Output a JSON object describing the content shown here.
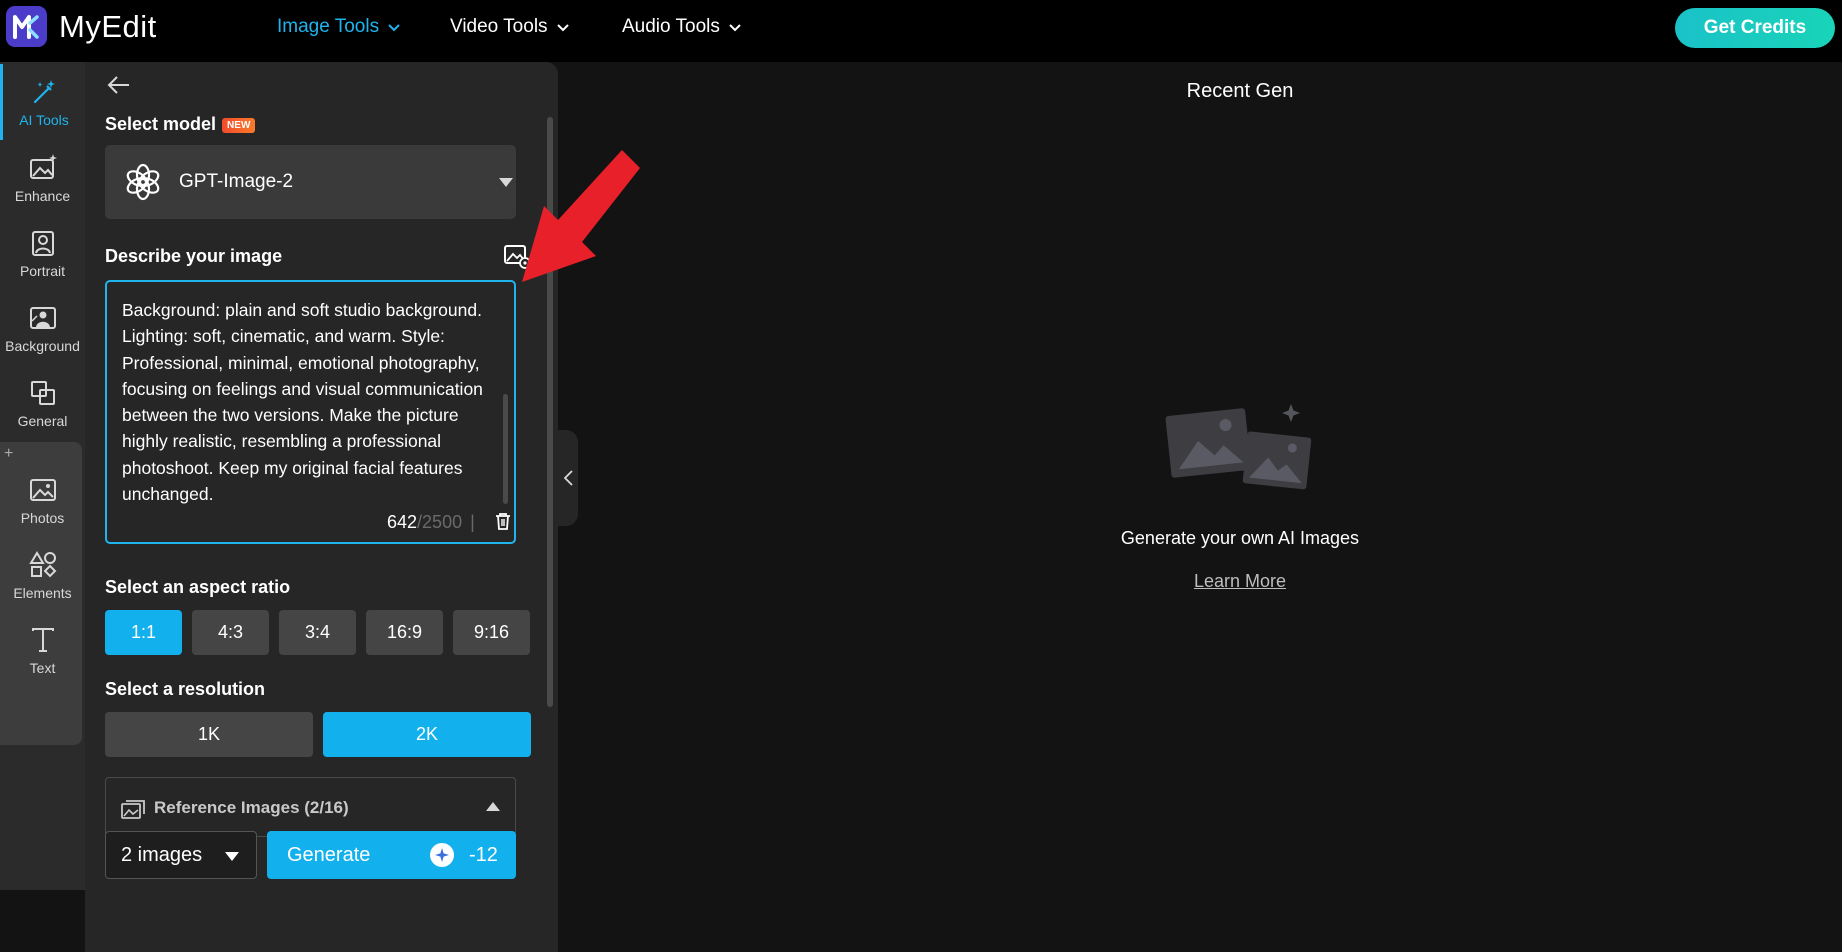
{
  "app": {
    "name": "MyEdit"
  },
  "nav": {
    "image_tools": "Image Tools",
    "video_tools": "Video Tools",
    "audio_tools": "Audio Tools",
    "get_credits": "Get Credits"
  },
  "rail": {
    "items": [
      {
        "label": "AI Tools",
        "icon": "magic-wand-icon"
      },
      {
        "label": "Enhance",
        "icon": "enhance-image-icon"
      },
      {
        "label": "Portrait",
        "icon": "portrait-icon"
      },
      {
        "label": "Background",
        "icon": "background-icon"
      },
      {
        "label": "General",
        "icon": "general-icon"
      },
      {
        "label": "Photos",
        "icon": "photos-icon"
      },
      {
        "label": "Elements",
        "icon": "elements-icon"
      },
      {
        "label": "Text",
        "icon": "text-icon"
      }
    ],
    "plus": "+"
  },
  "panel": {
    "select_model_label": "Select model",
    "new_badge": "NEW",
    "model_name": "GPT-Image-2",
    "describe_label": "Describe your image",
    "prompt": "Background: plain and soft studio background. Lighting: soft, cinematic, and warm. Style: Professional, minimal, emotional photography, focusing on feelings and visual communication between the two versions. Make the picture highly realistic, resembling a professional photoshoot. Keep my original facial features unchanged.",
    "char_count": "642",
    "char_max": "/2500",
    "char_sep": "|",
    "aspect_label": "Select an aspect ratio",
    "aspect_options": [
      "1:1",
      "4:3",
      "3:4",
      "16:9",
      "9:16"
    ],
    "aspect_selected": "1:1",
    "resolution_label": "Select a resolution",
    "resolution_options": [
      "1K",
      "2K"
    ],
    "resolution_selected": "2K",
    "reference_label": "Reference Images (2/16)",
    "image_count": "2 images",
    "generate_label": "Generate",
    "generate_cost": "-12"
  },
  "main": {
    "recent_title": "Recent Gen",
    "empty_text": "Generate your own AI Images",
    "learn_more": "Learn More"
  },
  "colors": {
    "accent": "#1fb4ee",
    "button_on": "#12b0ec",
    "credits_gradient": "#1ac2c8",
    "annotation_arrow": "#e8202a"
  }
}
